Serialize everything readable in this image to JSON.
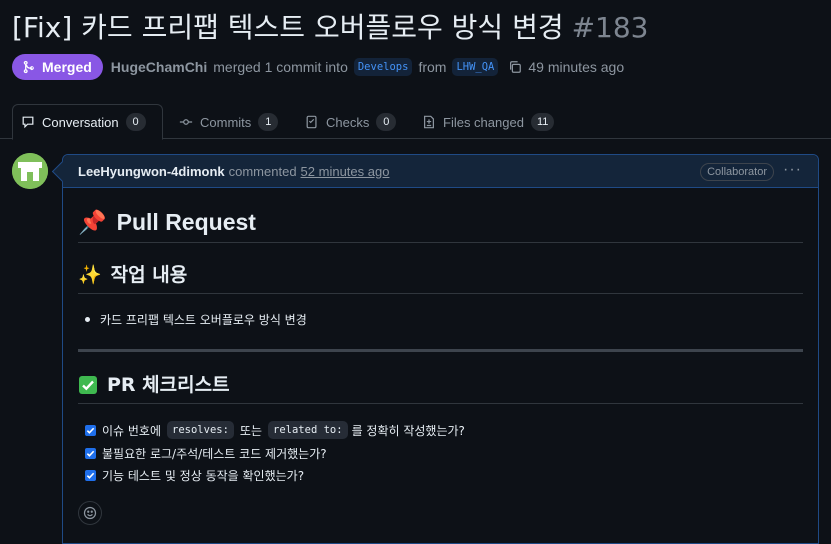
{
  "pr": {
    "title": "[Fix] 카드 프리팹 텍스트 오버플로우 방식 변경",
    "number": "#183",
    "status": "Merged",
    "author": "HugeChamChi",
    "action": "merged 1 commit into",
    "base_branch": "Develops",
    "from_text": "from",
    "head_branch": "LHW_QA",
    "time": "49 minutes ago"
  },
  "tabs": [
    {
      "label": "Conversation",
      "count": "0",
      "icon": "comment-icon"
    },
    {
      "label": "Commits",
      "count": "1",
      "icon": "commit-icon"
    },
    {
      "label": "Checks",
      "count": "0",
      "icon": "checklist-icon"
    },
    {
      "label": "Files changed",
      "count": "11",
      "icon": "file-diff-icon"
    }
  ],
  "comment": {
    "author": "LeeHyungwon-4dimonk",
    "action": "commented",
    "time": "52 minutes ago",
    "role": "Collaborator",
    "h1_emoji": "📌",
    "h1": "Pull Request",
    "h2_work_emoji": "✨",
    "h2_work": "작업 내용",
    "work_items": [
      "카드 프리팹 텍스트 오버플로우 방식 변경"
    ],
    "h2_check_emoji": "✅",
    "h2_check": "PR 체크리스트",
    "tasks": [
      {
        "pre": "이슈 번호에",
        "code1": "resolves:",
        "mid": "또는",
        "code2": "related to:",
        "post": "를 정확히 작성했는가?",
        "checked": true
      },
      {
        "text": "불필요한 로그/주석/테스트 코드 제거했는가?",
        "checked": true
      },
      {
        "text": "기능 테스트 및 정상 동작을 확인했는가?",
        "checked": true
      }
    ]
  },
  "colors": {
    "merged": "#8957e5",
    "background": "#0d1117",
    "accent": "#1f6feb",
    "header": "#14253a"
  }
}
